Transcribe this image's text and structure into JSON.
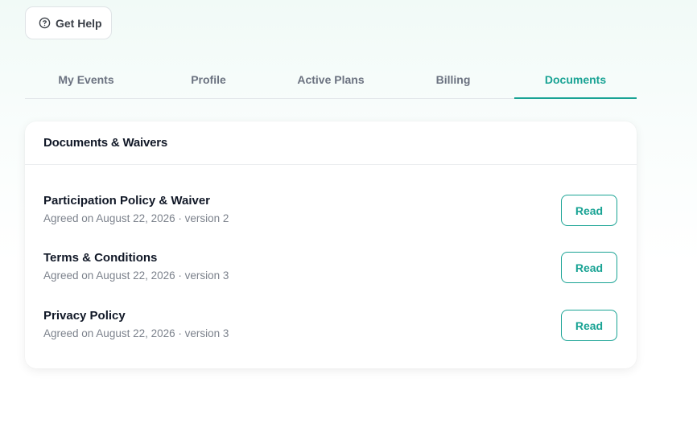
{
  "help": {
    "label": "Get Help",
    "icon": "question-circle-icon"
  },
  "tabs": [
    {
      "label": "My Events"
    },
    {
      "label": "Profile"
    },
    {
      "label": "Active Plans"
    },
    {
      "label": "Billing"
    },
    {
      "label": "Documents",
      "active": true
    }
  ],
  "card": {
    "title": "Documents & Waivers",
    "documents": [
      {
        "title": "Participation Policy & Waiver",
        "meta": "Agreed on August 22, 2026 · version 2",
        "action": "Read"
      },
      {
        "title": "Terms & Conditions",
        "meta": "Agreed on August 22, 2026 · version 3",
        "action": "Read"
      },
      {
        "title": "Privacy Policy",
        "meta": "Agreed on August 22, 2026 · version 3",
        "action": "Read"
      }
    ]
  },
  "colors": {
    "accent": "#19a394",
    "text": "#111827",
    "muted": "#7c828c"
  }
}
